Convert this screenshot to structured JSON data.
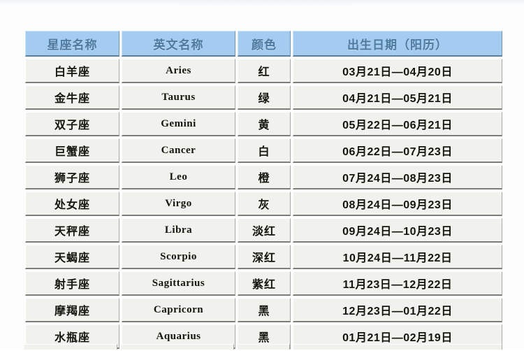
{
  "page": {
    "background_color": "#fdfdfd",
    "ghost_top_text": "· · · ·      · ·      · · · ·"
  },
  "table": {
    "header_bg_color": "#a4cbf0",
    "header_text_color": "#4d7a9e",
    "cell_bg_color": "#f1f1ed",
    "cell_text_color": "#15150f",
    "columns": [
      {
        "key": "name",
        "label": "星座名称"
      },
      {
        "key": "en",
        "label": "英文名称"
      },
      {
        "key": "color",
        "label": "颜色"
      },
      {
        "key": "date",
        "label": "出生日期（阳历）"
      }
    ],
    "rows": [
      {
        "name": "白羊座",
        "en": "Aries",
        "color": "红",
        "date": "03月21日—04月20日"
      },
      {
        "name": "金牛座",
        "en": "Taurus",
        "color": "绿",
        "date": "04月21日—05月21日"
      },
      {
        "name": "双子座",
        "en": "Gemini",
        "color": "黄",
        "date": "05月22日—06月21日"
      },
      {
        "name": "巨蟹座",
        "en": "Cancer",
        "color": "白",
        "date": "06月22日—07月23日"
      },
      {
        "name": "狮子座",
        "en": "Leo",
        "color": "橙",
        "date": "07月24日—08月23日"
      },
      {
        "name": "处女座",
        "en": "Virgo",
        "color": "灰",
        "date": "08月24日—09月23日"
      },
      {
        "name": "天秤座",
        "en": "Libra",
        "color": "淡红",
        "date": "09月24日—10月23日"
      },
      {
        "name": "天蝎座",
        "en": "Scorpio",
        "color": "深红",
        "date": "10月24日—11月22日"
      },
      {
        "name": "射手座",
        "en": "Sagittarius",
        "color": "紫红",
        "date": "11月23日—12月22日"
      },
      {
        "name": "摩羯座",
        "en": "Capricorn",
        "color": "黑",
        "date": "12月23日—01月22日"
      },
      {
        "name": "水瓶座",
        "en": "Aquarius",
        "color": "黑",
        "date": "01月21日—02月19日"
      }
    ]
  }
}
